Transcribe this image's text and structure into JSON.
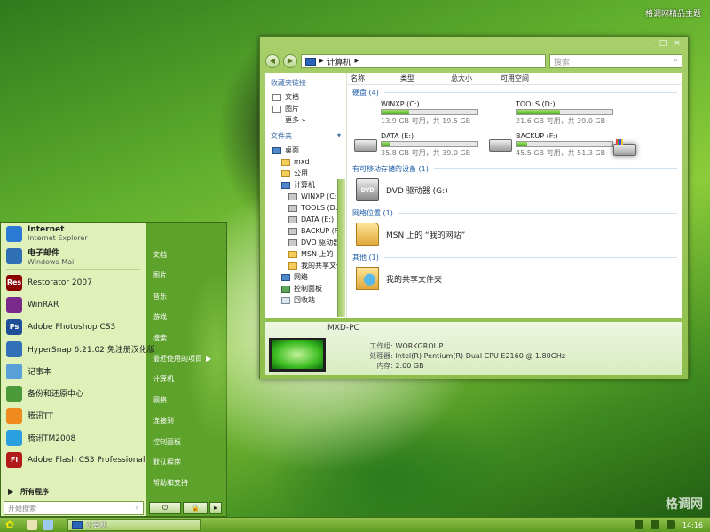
{
  "brand": "格调网精品主题",
  "watermark": "格调网",
  "explorer": {
    "controls": {
      "minimize": "—",
      "maximize": "□",
      "close": "×"
    },
    "address": {
      "path": "计算机",
      "arrow_left": "▸",
      "arrow_right": "▸"
    },
    "search_placeholder": "搜索",
    "search_icon": "⌕",
    "nav_back": "◀",
    "nav_forward": "▶",
    "favorites_header": "收藏夹链接",
    "favorites": [
      {
        "label": "文档",
        "icon": "document-icon"
      },
      {
        "label": "图片",
        "icon": "pictures-icon"
      },
      {
        "label": "更多  »",
        "icon": ""
      }
    ],
    "folders_header": "文件夹",
    "folders_toggle": "▾",
    "tree": [
      {
        "label": "桌面",
        "level": 1,
        "icon": "desktop-icon"
      },
      {
        "label": "mxd",
        "level": 2,
        "icon": "folder-icon"
      },
      {
        "label": "公用",
        "level": 2,
        "icon": "folder-icon"
      },
      {
        "label": "计算机",
        "level": 2,
        "icon": "computer-icon"
      },
      {
        "label": "WINXP (C:)",
        "level": 3,
        "icon": "drive-icon"
      },
      {
        "label": "TOOLS (D:)",
        "level": 3,
        "icon": "drive-icon"
      },
      {
        "label": "DATA (E:)",
        "level": 3,
        "icon": "drive-icon"
      },
      {
        "label": "BACKUP (F:)",
        "level": 3,
        "icon": "drive-icon"
      },
      {
        "label": "DVD 驱动器",
        "level": 3,
        "icon": "dvd-icon"
      },
      {
        "label": "MSN 上的",
        "level": 3,
        "icon": "folder-icon"
      },
      {
        "label": "我的共享文件",
        "level": 3,
        "icon": "folder-icon"
      },
      {
        "label": "网络",
        "level": 2,
        "icon": "network-icon"
      },
      {
        "label": "控制面板",
        "level": 2,
        "icon": "control-panel-icon"
      },
      {
        "label": "回收站",
        "level": 2,
        "icon": "recycle-bin-icon"
      }
    ],
    "columns": [
      "名称",
      "类型",
      "总大小",
      "可用空间"
    ],
    "groups": {
      "hdd": "硬盘 (4)",
      "removable": "有可移动存储的设备 (1)",
      "network": "网络位置 (1)",
      "other": "其他 (1)"
    },
    "drives": [
      {
        "name": "WINXP (C:)",
        "free": "13.9 GB 可用，共 19.5 GB",
        "used_fraction": 0.29,
        "icon": "windows-drive-icon"
      },
      {
        "name": "TOOLS (D:)",
        "free": "21.6 GB 可用，共 39.0 GB",
        "used_fraction": 0.45,
        "icon": "windows-drive-icon"
      },
      {
        "name": "DATA (E:)",
        "free": "35.8 GB 可用，共 39.0 GB",
        "used_fraction": 0.08,
        "icon": "drive-icon"
      },
      {
        "name": "BACKUP (F:)",
        "free": "45.5 GB 可用，共 51.3 GB",
        "used_fraction": 0.11,
        "icon": "drive-icon"
      }
    ],
    "dvd": {
      "name": "DVD 驱动器 (G:)",
      "badge": "DVD"
    },
    "netplace": "MSN 上的 “我的网站”",
    "shared": "我的共享文件夹",
    "details": {
      "pc_name": "MXD-PC",
      "workgroup_label": "工作组:",
      "workgroup": "WORKGROUP",
      "cpu_label": "处理器:",
      "cpu": "Intel(R) Pentium(R) Dual  CPU  E2160  @ 1.80GHz",
      "mem_label": "内存:",
      "mem": "2.00 GB"
    }
  },
  "start": {
    "pinned": [
      {
        "title": "Internet",
        "subtitle": "Internet Explorer",
        "icon": "ie-icon",
        "color": "#2b7bd6"
      },
      {
        "title": "电子邮件",
        "subtitle": "Windows Mail",
        "icon": "mail-icon",
        "color": "#2f6fb3"
      }
    ],
    "programs": [
      {
        "label": "Restorator 2007",
        "icon": "restorator-icon",
        "color": "#8b0000",
        "glyph": "Res"
      },
      {
        "label": "WinRAR",
        "icon": "winrar-icon",
        "color": "#7a2a8a",
        "glyph": ""
      },
      {
        "label": "Adobe Photoshop CS3",
        "icon": "photoshop-icon",
        "color": "#1f4f99",
        "glyph": "Ps"
      },
      {
        "label": "HyperSnap 6.21.02 免注册汉化版",
        "icon": "hypersnap-icon",
        "color": "#3270b8",
        "glyph": ""
      },
      {
        "label": "记事本",
        "icon": "notepad-icon",
        "color": "#5aa0d8",
        "glyph": ""
      },
      {
        "label": "备份和还原中心",
        "icon": "backup-icon",
        "color": "#4a9a3a",
        "glyph": ""
      },
      {
        "label": "腾讯TT",
        "icon": "tencent-tt-icon",
        "color": "#f08a1c",
        "glyph": ""
      },
      {
        "label": "腾讯TM2008",
        "icon": "tencent-tm-icon",
        "color": "#2aa0e0",
        "glyph": ""
      },
      {
        "label": "Adobe Flash CS3 Professional",
        "icon": "flash-icon",
        "color": "#b31b1b",
        "glyph": "Fl"
      }
    ],
    "all_programs": "所有程序",
    "all_programs_arrow": "▶",
    "search_placeholder": "开始搜索",
    "search_icon": "⌕",
    "right_items": [
      "文档",
      "图片",
      "音乐",
      "游戏",
      "搜索",
      "最近使用的项目",
      "计算机",
      "网络",
      "连接到",
      "控制面板",
      "默认程序",
      "帮助和支持"
    ],
    "recent_arrow": "▶",
    "power": {
      "power": "⏻",
      "lock": "🔒",
      "more": "▸"
    }
  },
  "taskbar": {
    "start_glyph": "✿",
    "task_label": "计算机",
    "clock": "14:16"
  }
}
